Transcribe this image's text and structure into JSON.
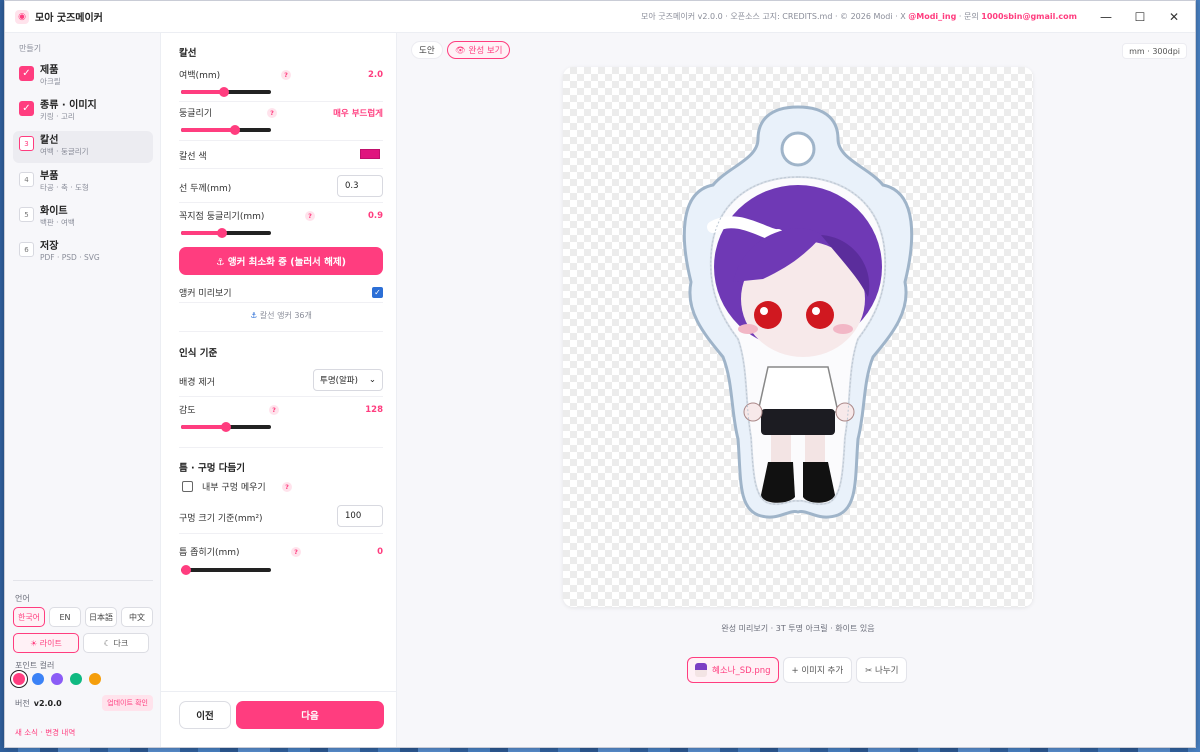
{
  "app": {
    "title": "모아 굿즈메이커",
    "meta_plain": "모아 굿즈메이커 v2.0.0 · 오픈소스 고지: CREDITS.md · © 2026 Modi · X",
    "meta_handle": "@Modi_ing",
    "meta_mid": "· 문의",
    "meta_email": "1000sbin@gmail.com"
  },
  "sidebar": {
    "section_label": "만들기",
    "steps": [
      {
        "num": "✓",
        "title": "제품",
        "sub": "아크릴"
      },
      {
        "num": "✓",
        "title": "종류 · 이미지",
        "sub": "키링 · 고리"
      },
      {
        "num": "3",
        "title": "칼선",
        "sub": "여백 · 둥글리기"
      },
      {
        "num": "4",
        "title": "부품",
        "sub": "타공 · 축 · 도형"
      },
      {
        "num": "5",
        "title": "화이트",
        "sub": "백판 · 여백"
      },
      {
        "num": "6",
        "title": "저장",
        "sub": "PDF · PSD · SVG"
      }
    ],
    "lang_label": "언어",
    "langs": [
      "한국어",
      "EN",
      "日本語",
      "中文"
    ],
    "theme_light": "☀ 라이트",
    "theme_dark": "☾ 다크",
    "color_label": "포인트 컬러",
    "colors": [
      "#ff3d7f",
      "#3b82f6",
      "#8b5cf6",
      "#10b981",
      "#f59e0b"
    ],
    "version_label": "버전",
    "version": "v2.0.0",
    "update_btn": "업데이트 확인",
    "news": "새 소식 · 변경 내역"
  },
  "panel": {
    "cut_title": "칼선",
    "margin_label": "여백(mm)",
    "margin_value": "2.0",
    "margin_frac": 0.48,
    "round_label": "둥글리기",
    "round_value": "매우 부드럽게",
    "round_frac": 0.6,
    "cut_color_label": "칼선 색",
    "cut_color": "#e0157e",
    "line_width_label": "선 두께(mm)",
    "line_width_value": "0.3",
    "corner_label": "꼭지점 둥글리기(mm)",
    "corner_value": "0.9",
    "corner_frac": 0.45,
    "anchor_btn": "⚓ 앵커 최소화 중 (눌러서 해제)",
    "anchor_preview_label": "앵커 미리보기",
    "anchor_info_icon": "⚓",
    "anchor_info": "칼선 앵커 36개",
    "detect_title": "인식 기준",
    "bg_remove_label": "배경 제거",
    "bg_remove_value": "투명(알파)",
    "sensitivity_label": "감도",
    "sensitivity_value": "128",
    "sensitivity_frac": 0.5,
    "gap_title": "틈 · 구멍 다듬기",
    "fill_holes_label": "내부 구멍 메우기",
    "hole_size_label": "구멍 크기 기준(mm²)",
    "hole_size_value": "100",
    "narrow_label": "틈 좁히기(mm)",
    "narrow_value": "0",
    "narrow_frac": 0.0,
    "help": "?",
    "prev_btn": "이전",
    "next_btn": "다음"
  },
  "main": {
    "tab_plain": "도안",
    "tab_active": "👁 완성 보기",
    "units": "mm · 300dpi",
    "caption": "완성 미리보기 · 3T 투명 아크릴 · 화이트 있음",
    "file_name": "혜소나_SD.png",
    "add_image": "+ 이미지 추가",
    "split": "✂ 나누기"
  }
}
